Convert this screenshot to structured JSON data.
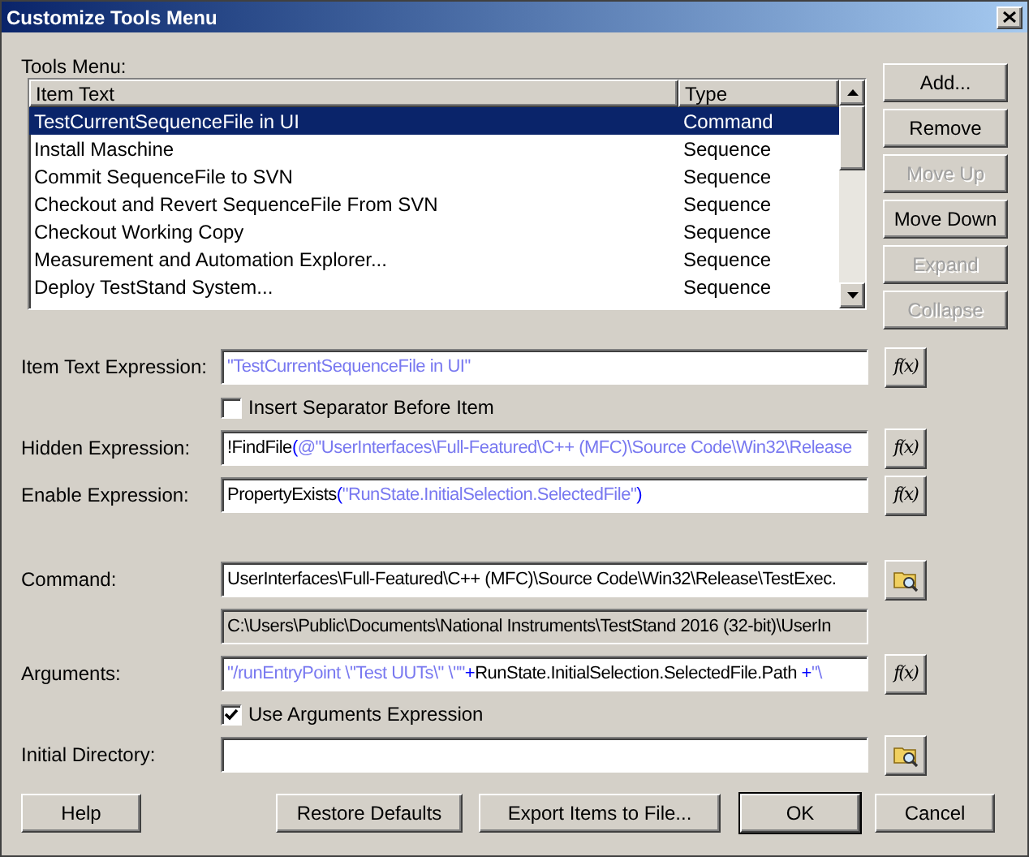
{
  "window": {
    "title": "Customize Tools Menu"
  },
  "tools_menu": {
    "label": "Tools Menu:",
    "columns": [
      "Item Text",
      "Type"
    ],
    "rows": [
      {
        "item_text": "TestCurrentSequenceFile in UI",
        "type": "Command",
        "selected": true
      },
      {
        "item_text": "Install Maschine",
        "type": "Sequence",
        "selected": false
      },
      {
        "item_text": "Commit SequenceFile to SVN",
        "type": "Sequence",
        "selected": false
      },
      {
        "item_text": "Checkout and Revert SequenceFile From SVN",
        "type": "Sequence",
        "selected": false
      },
      {
        "item_text": "Checkout Working Copy",
        "type": "Sequence",
        "selected": false
      },
      {
        "item_text": "Measurement and Automation Explorer...",
        "type": "Sequence",
        "selected": false
      },
      {
        "item_text": "Deploy TestStand System...",
        "type": "Sequence",
        "selected": false
      }
    ]
  },
  "side_buttons": [
    {
      "label": "Add...",
      "disabled": false
    },
    {
      "label": "Remove",
      "disabled": false
    },
    {
      "label": "Move Up",
      "disabled": true
    },
    {
      "label": "Move Down",
      "disabled": false
    },
    {
      "label": "Expand",
      "disabled": true
    },
    {
      "label": "Collapse",
      "disabled": true
    }
  ],
  "sections": [
    [
      {
        "kind": "expression",
        "label": "Item Text Expression:",
        "button_label": "f(x)",
        "tokens": [
          {
            "kind": "string",
            "text": "\"TestCurrentSequenceFile in UI\""
          }
        ]
      },
      {
        "kind": "checkbox",
        "label": "Insert Separator Before Item",
        "checked": false
      },
      {
        "kind": "expression",
        "label": "Hidden Expression:",
        "button_label": "f(x)",
        "tokens": [
          {
            "kind": "ident",
            "text": "!FindFile"
          },
          {
            "kind": "op",
            "text": "("
          },
          {
            "kind": "string",
            "text": "@\"UserInterfaces\\Full-Featured\\C++ (MFC)\\Source Code\\Win32\\Release"
          }
        ]
      },
      {
        "kind": "expression",
        "label": "Enable Expression:",
        "button_label": "f(x)",
        "tokens": [
          {
            "kind": "ident",
            "text": "PropertyExists"
          },
          {
            "kind": "op",
            "text": "("
          },
          {
            "kind": "string",
            "text": "\"RunState.InitialSelection.SelectedFile\""
          },
          {
            "kind": "op",
            "text": ")"
          }
        ]
      }
    ],
    [
      {
        "kind": "browse",
        "label": "Command:",
        "tokens": [
          {
            "kind": "ident",
            "text": "UserInterfaces\\Full-Featured\\C++ (MFC)\\Source Code\\Win32\\Release\\TestExec."
          }
        ]
      },
      {
        "kind": "readonly",
        "tokens": [
          {
            "kind": "ident",
            "text": "C:\\Users\\Public\\Documents\\National Instruments\\TestStand 2016 (32-bit)\\UserIn"
          }
        ]
      },
      {
        "kind": "expression",
        "label": "Arguments:",
        "button_label": "f(x)",
        "tokens": [
          {
            "kind": "string",
            "text": "\"/runEntryPoint \\\"Test UUTs\\\" \\\"\""
          },
          {
            "kind": "op",
            "text": "+"
          },
          {
            "kind": "ident",
            "text": "RunState.InitialSelection.SelectedFile.Path "
          },
          {
            "kind": "op",
            "text": "+"
          },
          {
            "kind": "string",
            "text": "\"\\"
          }
        ]
      },
      {
        "kind": "checkbox",
        "label": "Use Arguments Expression",
        "checked": true
      },
      {
        "kind": "browse",
        "label": "Initial Directory:"
      }
    ]
  ],
  "bottom_buttons": [
    {
      "label": "Help",
      "default": false
    },
    {
      "label": "Restore Defaults",
      "default": false
    },
    {
      "label": "Export Items to File...",
      "default": false
    },
    {
      "label": "OK",
      "default": true
    },
    {
      "label": "Cancel",
      "default": false
    }
  ]
}
